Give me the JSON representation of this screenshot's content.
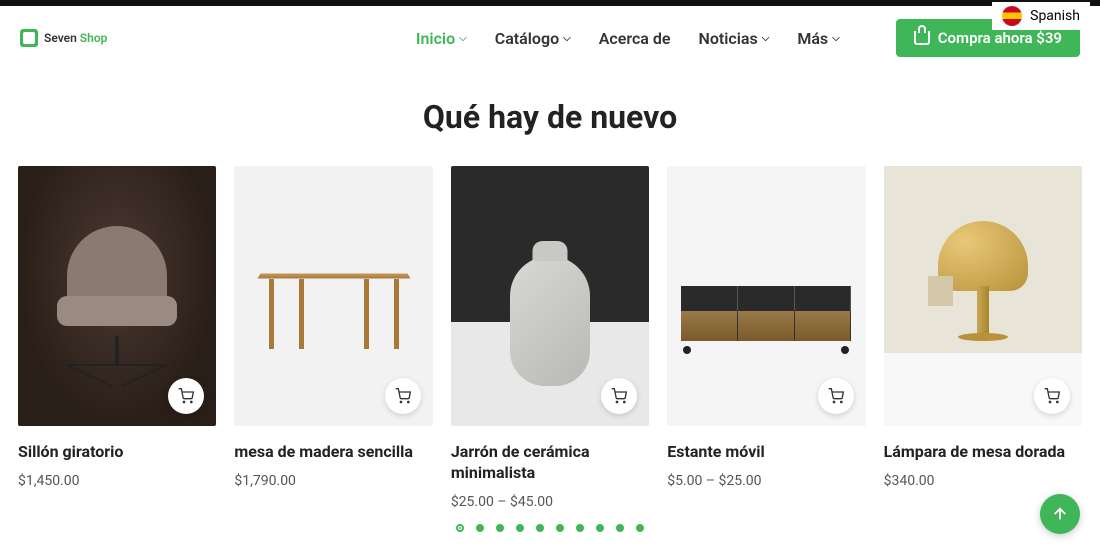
{
  "language": {
    "label": "Spanish"
  },
  "logo": {
    "text1": "Seven",
    "text2": "Shop"
  },
  "nav": {
    "items": [
      {
        "label": "Inicio",
        "active": true,
        "dropdown": true
      },
      {
        "label": "Catálogo",
        "active": false,
        "dropdown": true
      },
      {
        "label": "Acerca de",
        "active": false,
        "dropdown": false
      },
      {
        "label": "Noticias",
        "active": false,
        "dropdown": true
      },
      {
        "label": "Más",
        "active": false,
        "dropdown": true
      }
    ]
  },
  "cta": {
    "label": "Compra ahora $39"
  },
  "section": {
    "title": "Qué hay de nuevo"
  },
  "products": [
    {
      "name": "Sillón giratorio",
      "price": "$1,450.00"
    },
    {
      "name": "mesa de madera sencilla",
      "price": "$1,790.00"
    },
    {
      "name": "Jarrón de cerámica minimalista",
      "price": "$25.00 – $45.00"
    },
    {
      "name": "Estante móvil",
      "price": "$5.00 – $25.00"
    },
    {
      "name": "Lámpara de mesa dorada",
      "price": "$340.00"
    }
  ],
  "carousel": {
    "dot_count": 10,
    "active_index": 0
  }
}
